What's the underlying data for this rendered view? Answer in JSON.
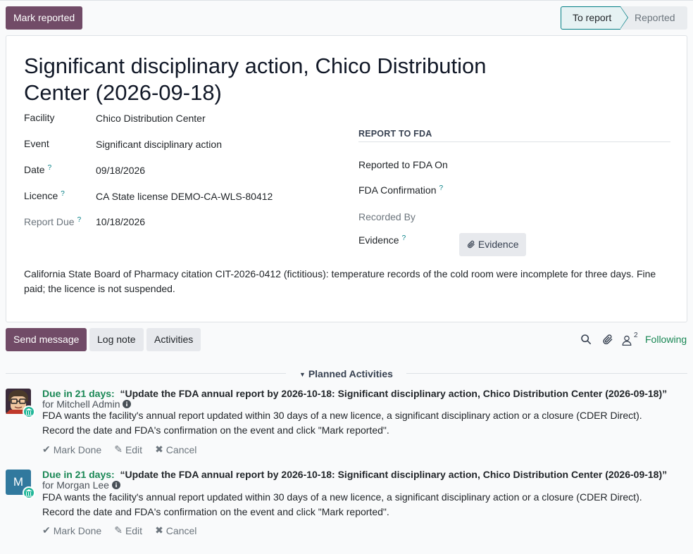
{
  "control": {
    "mark_reported": "Mark reported",
    "status": [
      "To report",
      "Reported"
    ]
  },
  "form": {
    "title": "Significant disciplinary action, Chico Distribution Center (2026-09-18)",
    "fields": {
      "facility_label": "Facility",
      "facility_value": "Chico Distribution Center",
      "event_label": "Event",
      "event_value": "Significant disciplinary action",
      "date_label": "Date",
      "date_value": "09/18/2026",
      "licence_label": "Licence",
      "licence_value": "CA State license DEMO-CA-WLS-80412",
      "report_due_label": "Report Due",
      "report_due_value": "10/18/2026"
    },
    "fda_section": {
      "title": "REPORT TO FDA",
      "reported_on_label": "Reported to FDA On",
      "confirmation_label": "FDA Confirmation",
      "recorded_by_label": "Recorded By",
      "evidence_label": "Evidence",
      "evidence_button": "Evidence"
    },
    "help_mark": "?",
    "description": "California State Board of Pharmacy citation CIT-2026-0412 (fictitious): temperature records of the cold room were incomplete for three days. Fine paid; the licence is not suspended."
  },
  "chatter": {
    "send_message": "Send message",
    "log_note": "Log note",
    "activities": "Activities",
    "follower_count": "2",
    "following": "Following",
    "planned_activities": "Planned Activities",
    "items": [
      {
        "due": "Due in 21 days:",
        "summary": "“Update the FDA annual report by 2026-10-18: Significant disciplinary action, Chico Distribution Center (2026-09-18)”",
        "for": "for Mitchell Admin",
        "note": "FDA wants the facility's annual report updated within 30 days of a new licence, a significant disciplinary action or a closure (CDER Direct). Record the date and FDA's confirmation on the event and click \"Mark reported\".",
        "mark_done": "Mark Done",
        "edit": "Edit",
        "cancel": "Cancel"
      },
      {
        "due": "Due in 21 days:",
        "summary": "“Update the FDA annual report by 2026-10-18: Significant disciplinary action, Chico Distribution Center (2026-09-18)”",
        "for": "for Morgan Lee",
        "avatar_letter": "M",
        "note": "FDA wants the facility's annual report updated within 30 days of a new licence, a significant disciplinary action or a closure (CDER Direct). Record the date and FDA's confirmation on the event and click \"Mark reported\".",
        "mark_done": "Mark Done",
        "edit": "Edit",
        "cancel": "Cancel"
      }
    ]
  },
  "colors": {
    "primary": "#714b67",
    "accent": "#017e84",
    "due": "#198754"
  }
}
